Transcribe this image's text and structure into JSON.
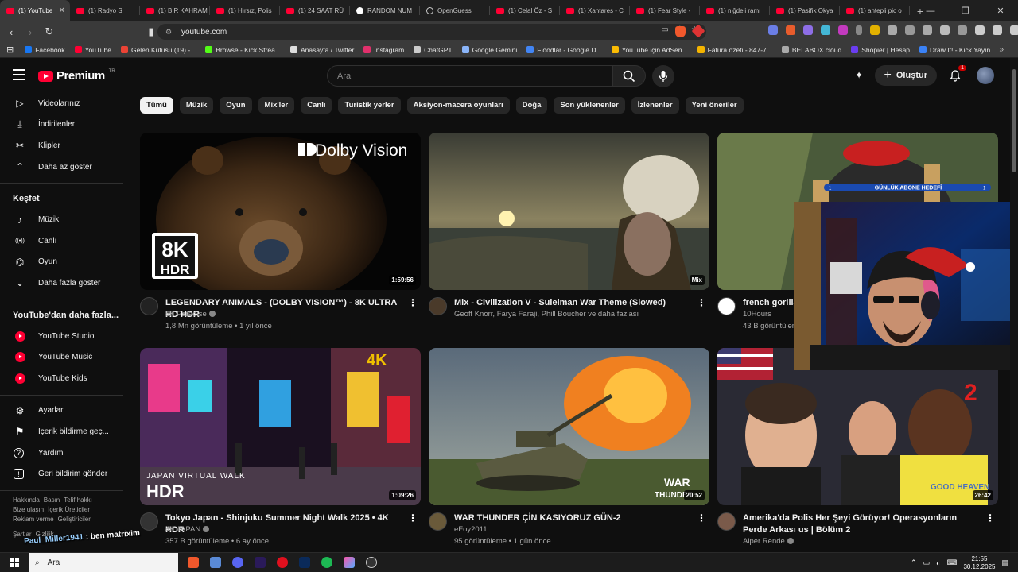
{
  "browser": {
    "tabs": [
      {
        "label": "(1) YouTube",
        "icon": "youtube"
      },
      {
        "label": "(1) Radyo S",
        "icon": "youtube"
      },
      {
        "label": "(1) BİR KAHRAM",
        "icon": "youtube"
      },
      {
        "label": "(1) Hırsız, Polis",
        "icon": "youtube"
      },
      {
        "label": "(1) 24 SAAT RÜ",
        "icon": "youtube"
      },
      {
        "label": "RANDOM NUM",
        "icon": "google"
      },
      {
        "label": "OpenGuess",
        "icon": "openguessr"
      },
      {
        "label": "(1) Celal Öz - S",
        "icon": "youtube"
      },
      {
        "label": "(1) Xantares - C",
        "icon": "youtube"
      },
      {
        "label": "(1) Fear Style -",
        "icon": "youtube"
      },
      {
        "label": "(1) niğdeli ramı",
        "icon": "youtube"
      },
      {
        "label": "(1) Pasifik Okya",
        "icon": "youtube"
      },
      {
        "label": "(1) antepli pic o",
        "icon": "youtube"
      }
    ],
    "url": "youtube.com",
    "bookmarks": [
      {
        "label": "Facebook",
        "color": "#1877f2"
      },
      {
        "label": "YouTube",
        "color": "#ff0033"
      },
      {
        "label": "Gelen Kutusu (19) -...",
        "color": "#ea4335"
      },
      {
        "label": "Browse - Kick Strea...",
        "color": "#53fc18"
      },
      {
        "label": "Anasayfa / Twitter",
        "color": "#dddddd"
      },
      {
        "label": "Instagram",
        "color": "#e1306c"
      },
      {
        "label": "ChatGPT",
        "color": "#cccccc"
      },
      {
        "label": "Google Gemini",
        "color": "#8ab4f8"
      },
      {
        "label": "Floodlar - Google D...",
        "color": "#4285f4"
      },
      {
        "label": "YouTube için AdSen...",
        "color": "#fbbc04"
      },
      {
        "label": "Fatura özeti - 847-7...",
        "color": "#f4b400"
      },
      {
        "label": "BELABOX cloud",
        "color": "#aaaaaa"
      },
      {
        "label": "Shopier | Hesap",
        "color": "#6a3df0"
      },
      {
        "label": "Draw It! - Kick Yayın...",
        "color": "#3b82f6"
      }
    ]
  },
  "header": {
    "logo_text": "Premium",
    "logo_sup": "TR",
    "search_placeholder": "Ara",
    "create_label": "Oluştur",
    "notif_count": "1"
  },
  "sidebar": {
    "top_items": [
      {
        "label": "Videolarınız",
        "icon": "play-square-icon"
      },
      {
        "label": "İndirilenler",
        "icon": "download-icon"
      },
      {
        "label": "Klipler",
        "icon": "scissors-icon"
      },
      {
        "label": "Daha az göster",
        "icon": "chevron-up-icon"
      }
    ],
    "explore_title": "Keşfet",
    "explore_items": [
      {
        "label": "Müzik",
        "icon": "music-note-icon"
      },
      {
        "label": "Canlı",
        "icon": "live-icon"
      },
      {
        "label": "Oyun",
        "icon": "gamepad-icon"
      },
      {
        "label": "Daha fazla göster",
        "icon": "chevron-down-icon"
      }
    ],
    "more_title": "YouTube'dan daha fazla...",
    "more_items": [
      {
        "label": "YouTube Studio"
      },
      {
        "label": "YouTube Music"
      },
      {
        "label": "YouTube Kids"
      }
    ],
    "settings_items": [
      {
        "label": "Ayarlar",
        "icon": "gear-icon"
      },
      {
        "label": "İçerik bildirme geç...",
        "icon": "flag-icon"
      },
      {
        "label": "Yardım",
        "icon": "help-icon"
      },
      {
        "label": "Geri bildirim gönder",
        "icon": "feedback-icon"
      }
    ],
    "footer_line1": [
      "Hakkında",
      "Basın",
      "Telif hakkı"
    ],
    "footer_line2": [
      "Bize ulaşın",
      "İçerik Üreticiler"
    ],
    "footer_line3": [
      "Reklam verme",
      "Geliştiriciler"
    ],
    "footer_line4": [
      "Şartlar",
      "Gizlilik"
    ]
  },
  "chips": [
    "Tümü",
    "Müzik",
    "Oyun",
    "Mix'ler",
    "Canlı",
    "Turistik yerler",
    "Aksiyon-macera oyunları",
    "Doğa",
    "Son yüklenenler",
    "İzlenenler",
    "Yeni öneriler"
  ],
  "videos": [
    {
      "title": "LEGENDARY ANIMALS - (DOLBY VISION™) - 8K ULTRA HD HDR",
      "channel": "8K Paradise",
      "stats": "1,8 Mn görüntüleme • 1 yıl önce",
      "duration": "1:59:56",
      "verified": true
    },
    {
      "title": "Mix - Civilization V - Suleiman War Theme (Slowed)",
      "channel": "Geoff Knorr, Farya Faraji, Phill Boucher ve daha fazlası",
      "stats": "",
      "duration": "Mix",
      "verified": false
    },
    {
      "title": "french gorilla",
      "channel": "10Hours",
      "stats": "43 B görüntüleme",
      "duration": "",
      "verified": false
    },
    {
      "title": "Tokyo Japan - Shinjuku Summer Night Walk 2025 • 4K HDR",
      "channel": "4K JAPAN",
      "stats": "357 B görüntüleme • 6 ay önce",
      "duration": "1:09:26",
      "verified": true
    },
    {
      "title": "WAR THUNDER ÇİN KASIYORUZ GÜN-2",
      "channel": "eFoy2011",
      "stats": "95 görüntüleme • 1 gün önce",
      "duration": "20:52",
      "verified": false
    },
    {
      "title": "Amerika'da Polis Her Şeyi Görüyor! Operasyonların Perde Arkası us | Bölüm 2",
      "channel": "Alper Rende",
      "stats": "",
      "duration": "26:42",
      "verified": true
    }
  ],
  "thumb_text": {
    "dolby": "Dolby Vision",
    "k8": "8K",
    "hdr": "HDR",
    "gorilla_banner": "GÜNLÜK ABONE HEDEFİ",
    "banner_left": "1",
    "banner_right": "1",
    "japan": "JAPAN VIRTUAL WALK",
    "japan_hdr": "HDR",
    "k4": "4K",
    "war": "WAR",
    "thunder": "THUNDER",
    "ep": "2"
  },
  "stream_overlay": {
    "user": "Paul_Miller1941",
    "message": " : ben matrixim"
  },
  "taskbar": {
    "search_placeholder": "Ara",
    "time": "21:55",
    "date": "30.12.2025"
  }
}
